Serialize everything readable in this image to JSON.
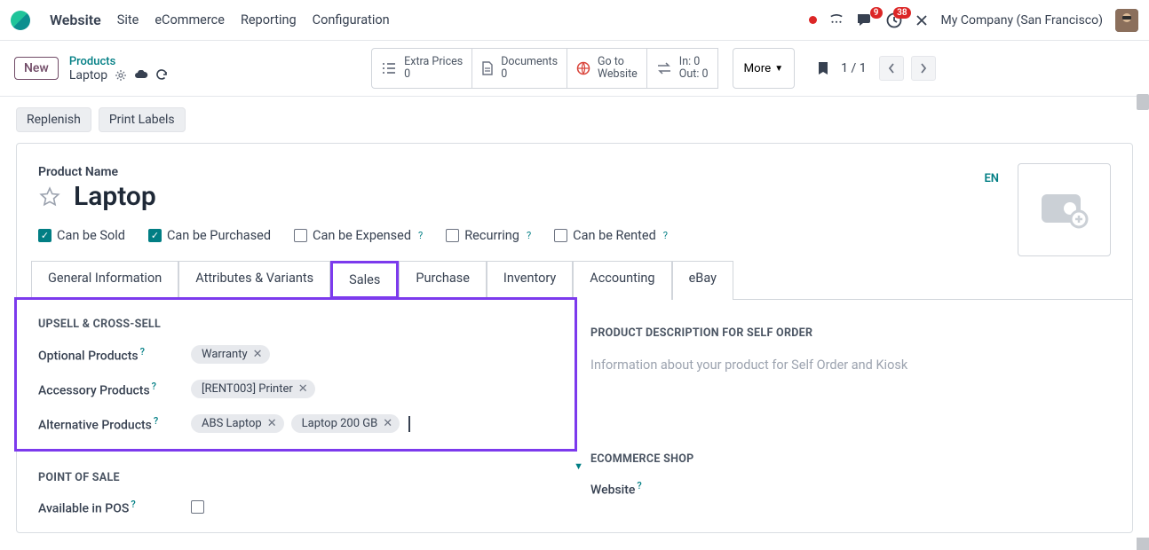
{
  "nav": {
    "brand": "Website",
    "links": [
      "Site",
      "eCommerce",
      "Reporting",
      "Configuration"
    ],
    "chat_badge": "9",
    "clock_badge": "38",
    "company": "My Company (San Francisco)"
  },
  "toolbar": {
    "new": "New",
    "crumb_parent": "Products",
    "crumb_title": "Laptop",
    "stats": {
      "extra_prices": {
        "label": "Extra Prices",
        "value": "0"
      },
      "documents": {
        "label": "Documents",
        "value": "0"
      },
      "go_to": {
        "label": "Go to",
        "value": "Website"
      },
      "in": {
        "label": "In:",
        "value": "0"
      },
      "out": {
        "label": "Out:",
        "value": "0"
      }
    },
    "more": "More",
    "page": "1 / 1"
  },
  "actions": {
    "replenish": "Replenish",
    "print_labels": "Print Labels"
  },
  "form": {
    "pname_label": "Product Name",
    "pname": "Laptop",
    "lang": "EN",
    "checks": {
      "sold": "Can be Sold",
      "purchased": "Can be Purchased",
      "expensed": "Can be Expensed",
      "recurring": "Recurring",
      "rented": "Can be Rented"
    },
    "tabs": [
      "General Information",
      "Attributes & Variants",
      "Sales",
      "Purchase",
      "Inventory",
      "Accounting",
      "eBay"
    ]
  },
  "sales": {
    "section1": "UPSELL & CROSS-SELL",
    "optional_label": "Optional Products",
    "optional_tags": [
      "Warranty"
    ],
    "accessory_label": "Accessory Products",
    "accessory_tags": [
      "[RENT003] Printer"
    ],
    "alternative_label": "Alternative Products",
    "alternative_tags": [
      "ABS Laptop",
      "Laptop 200 GB"
    ],
    "section2": "POINT OF SALE",
    "pos_label": "Available in POS",
    "section_r1": "PRODUCT DESCRIPTION FOR SELF ORDER",
    "desc_placeholder": "Information about your product for Self Order and Kiosk",
    "section_r2": "ECOMMERCE SHOP",
    "website_label": "Website"
  }
}
